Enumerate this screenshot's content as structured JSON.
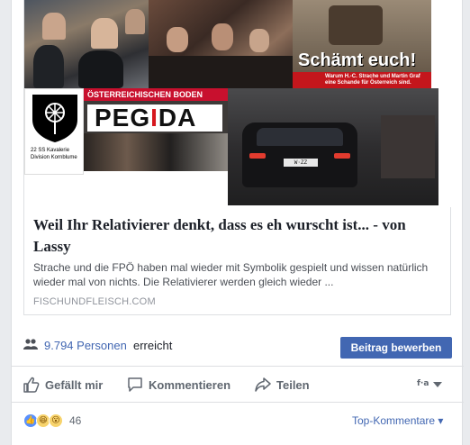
{
  "link": {
    "title": "Weil Ihr Relativierer denkt, dass es eh wurscht ist... - von Lassy",
    "description": "Strache und die FPÖ haben mal wieder mit Symbolik gespielt und wissen natürlich wieder mal von nichts. Die Relativierer werden gleich wieder ...",
    "domain": "FISCHUNDFLEISCH.COM"
  },
  "collage": {
    "schaemt_text": "Schämt euch!",
    "schaemt_subtext": "Warum H.-C. Strache und Martin Graf eine Schande für Österreich sind.",
    "banner_text": "ÖSTERREICHISCHEN BODEN",
    "pegida_prefix": "PEG",
    "pegida_red": "I",
    "pegida_suffix": "DA",
    "emblem_caption": "22 SS Kavalerie Division Kornblume",
    "plate_text": "W·ZZ"
  },
  "reach": {
    "count": "9.794 Personen",
    "label": "erreicht",
    "boost_button": "Beitrag bewerben"
  },
  "actions": {
    "like": "Gefällt mir",
    "comment": "Kommentieren",
    "share": "Teilen"
  },
  "reactions": {
    "count": "46",
    "top_comments": "Top-Kommentare ▾"
  }
}
